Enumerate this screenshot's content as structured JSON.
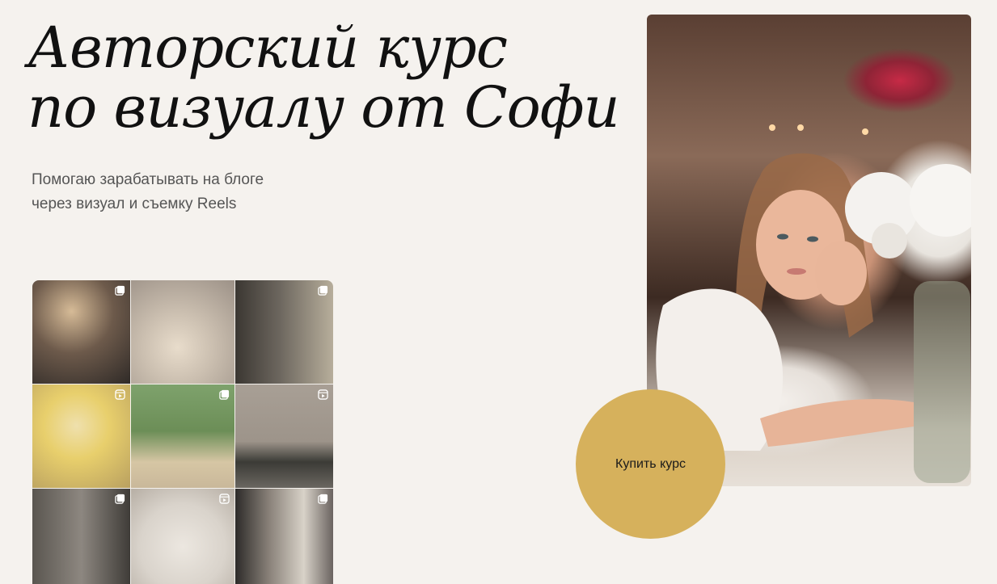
{
  "hero": {
    "title_line1": "Авторский курс",
    "title_line2": "по визуалу от Софи",
    "subtitle_line1": "Помогаю зарабатывать на блоге",
    "subtitle_line2": "через визуал и съемку Reels"
  },
  "cta": {
    "buy_label": "Купить курс",
    "color": "#d6b15c"
  },
  "feed": {
    "tiles": [
      {
        "badge": "carousel-icon"
      },
      {
        "badge": "none"
      },
      {
        "badge": "carousel-icon"
      },
      {
        "badge": "reels-icon"
      },
      {
        "badge": "carousel-icon"
      },
      {
        "badge": "reels-icon"
      },
      {
        "badge": "carousel-icon"
      },
      {
        "badge": "reels-icon"
      },
      {
        "badge": "carousel-icon"
      }
    ]
  },
  "colors": {
    "background": "#f5f2ee",
    "title": "#111111",
    "subtitle": "#555555"
  }
}
